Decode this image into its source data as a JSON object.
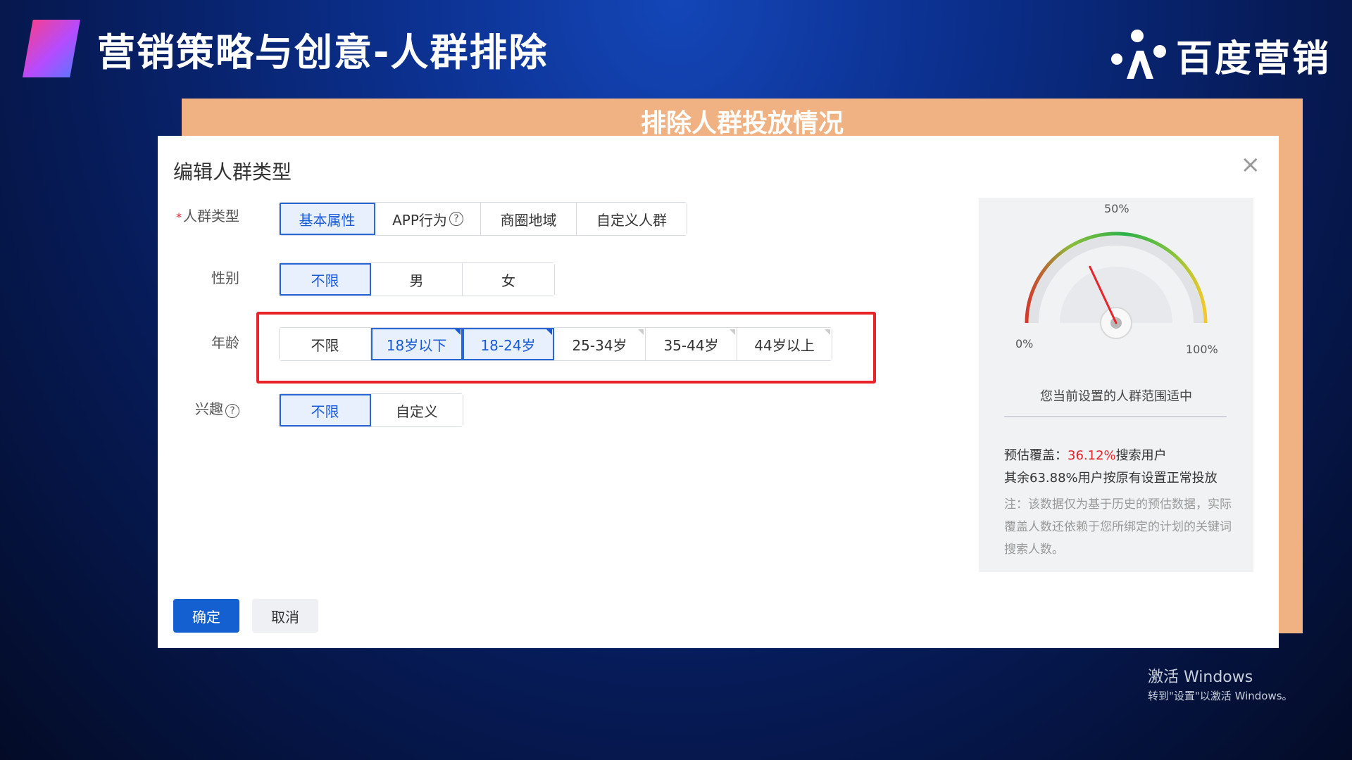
{
  "slide": {
    "title": "营销策略与创意-人群排除"
  },
  "brand": {
    "name": "百度营销",
    "icon": "baidu-paw-icon"
  },
  "orange_card": {
    "title": "排除人群投放情况"
  },
  "dialog": {
    "title": "编辑人群类型",
    "close_glyph": "×",
    "rows": {
      "crowd_type": {
        "required_mark": "*",
        "label": "人群类型",
        "options": [
          "基本属性",
          "APP行为",
          "商圈地域",
          "自定义人群"
        ],
        "selected": "基本属性",
        "help_glyph": "?"
      },
      "gender": {
        "label": "性别",
        "options": [
          "不限",
          "男",
          "女"
        ],
        "selected": "不限"
      },
      "age": {
        "label": "年龄",
        "options": [
          "不限",
          "18岁以下",
          "18-24岁",
          "25-34岁",
          "35-44岁",
          "44岁以上"
        ],
        "selected": [
          "18岁以下",
          "18-24岁"
        ]
      },
      "interest": {
        "label": "兴趣",
        "help_glyph": "?",
        "options": [
          "不限",
          "自定义"
        ],
        "selected": "不限"
      }
    },
    "confirm_label": "确定",
    "cancel_label": "取消"
  },
  "side_panel": {
    "gauge": {
      "label_mid": "50%",
      "label_min": "0%",
      "label_max": "100%",
      "needle_value_pct": 36.12
    },
    "caption": "您当前设置的人群范围适中",
    "estimate_prefix": "预估覆盖：",
    "estimate_value": "36.12%",
    "estimate_suffix": "搜索用户",
    "remainder": "其余63.88%用户按原有设置正常投放",
    "note": "注：该数据仅为基于历史的预估数据，实际覆盖人数还依赖于您所绑定的计划的关键词搜索人数。"
  },
  "watermark": {
    "line1": "激活 Windows",
    "line2": "转到\"设置\"以激活 Windows。"
  },
  "colors": {
    "accent_blue": "#1560d0",
    "highlight_red": "#e8232a",
    "orange_card": "#f0b283",
    "background_blue": "#0b2f8c"
  }
}
